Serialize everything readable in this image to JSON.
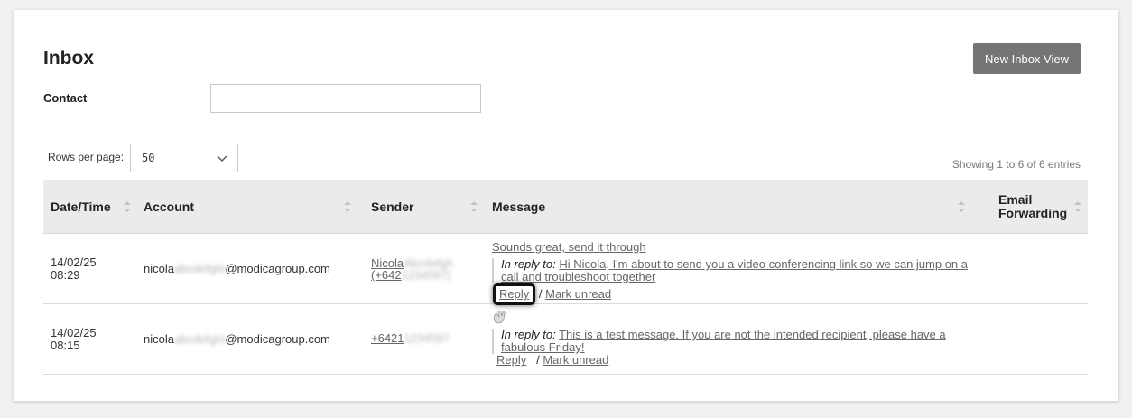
{
  "page": {
    "title": "Inbox",
    "new_view_button": "New Inbox View",
    "contact_label": "Contact",
    "contact_value": "",
    "rows_per_page_label": "Rows per page:",
    "rows_per_page_value": "50",
    "showing_text": "Showing 1 to 6 of 6 entries"
  },
  "table": {
    "headers": {
      "datetime": "Date/Time",
      "account": "Account",
      "sender": "Sender",
      "message": "Message",
      "email_forwarding_1": "Email",
      "email_forwarding_2": "Forwarding"
    },
    "rows": [
      {
        "date": "14/02/25",
        "time": "08:29",
        "account_prefix": "nicola",
        "account_redacted": "abcdefghi",
        "account_domain": "@modicagroup.com",
        "sender_line1": "Nicola",
        "sender_line1_redacted": "Abcdefgh",
        "sender_line2": "(+642",
        "sender_line2_redacted": "1234567)",
        "message": "Sounds great, send it through",
        "in_reply_to_label": "In reply to:",
        "in_reply_to_text": "Hi Nicola, I'm about to send you a video conferencing link so we can jump on a call and troubleshoot together",
        "reply_label": "Reply",
        "separator": "/",
        "mark_unread_label": "Mark unread"
      },
      {
        "date": "14/02/25",
        "time": "08:15",
        "account_prefix": "nicola",
        "account_redacted": "abcdefghi",
        "account_domain": "@modicagroup.com",
        "sender_line1": "+6421",
        "sender_line1_redacted": "1234567",
        "in_reply_to_label": "In reply to:",
        "in_reply_to_text": "This is a test message. If you are not the intended recipient, please have a fabulous Friday!",
        "reply_label": "Reply",
        "separator": "/",
        "mark_unread_label": "Mark unread"
      }
    ]
  },
  "icons": {
    "sort": "sort-icon",
    "chevron": "chevron-down-icon",
    "wave": "waving-hand-icon"
  },
  "colors": {
    "button_bg": "#757575",
    "header_bg": "#ebebeb",
    "link": "#666666"
  }
}
